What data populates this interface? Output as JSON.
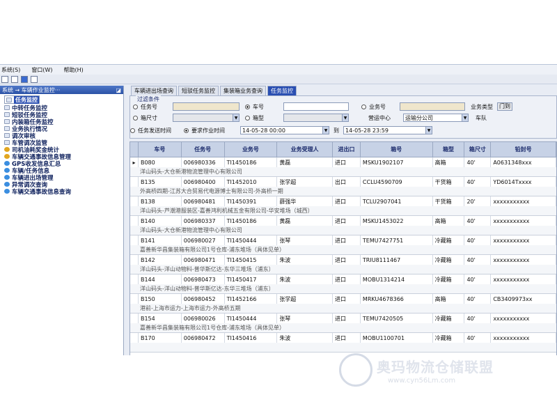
{
  "menu": [
    "系统(S)",
    "窗口(W)",
    "帮助(H)"
  ],
  "left_panel": {
    "header": "系统 → 车辆作业监控···",
    "items": [
      {
        "label": "任务监控",
        "icon": "doc-icon",
        "selected": true
      },
      {
        "label": "中转任务监控",
        "icon": "doc-icon"
      },
      {
        "label": "短驳任务监控",
        "icon": "doc-icon"
      },
      {
        "label": "内装箱任务监控",
        "icon": "doc-icon"
      },
      {
        "label": "业务执行情况",
        "icon": "doc-icon"
      },
      {
        "label": "调次审核",
        "icon": "doc-icon"
      },
      {
        "label": "车管调次监管",
        "icon": "doc-icon"
      },
      {
        "label": "司机油耗奖金统计",
        "icon": "key-icon"
      },
      {
        "label": "车辆交通事故信息管理",
        "icon": "key-icon"
      },
      {
        "label": "GPS收发信息汇总",
        "icon": "globe-icon"
      },
      {
        "label": "车辆/任务信息",
        "icon": "globe-icon"
      },
      {
        "label": "车辆进出场管理",
        "icon": "globe-icon"
      },
      {
        "label": "异常调次查询",
        "icon": "globe-icon"
      },
      {
        "label": "车辆交通事故信息查询",
        "icon": "globe-icon"
      }
    ]
  },
  "tabs": [
    "车辆进出场查询",
    "短驳任务监控",
    "集装箱业务查询",
    "任务监控"
  ],
  "active_tab": 3,
  "filter": {
    "title": "过滤条件",
    "task_no_label": "任务号",
    "car_no_label": "车号",
    "business_no_label": "业务号",
    "business_type_label": "业务类型",
    "business_type_value": "门到",
    "box_size_label": "箱尺寸",
    "box_type_label": "箱型",
    "center_label": "营运中心",
    "center_value": "运输分公司",
    "team_label": "车队",
    "send_time_label": "任务发送时间",
    "req_time_label": "要求作业时间",
    "time_from": "14-05-28 00:00",
    "to_label": "到",
    "time_to": "14-05-28 23:59"
  },
  "table": {
    "columns": [
      "车号",
      "任务号",
      "业务号",
      "业务受理人",
      "进出口",
      "箱号",
      "箱型",
      "箱尺寸",
      "铅封号"
    ],
    "rows": [
      {
        "cells": [
          "B080",
          "006980336",
          "TI1450186",
          "黄磊",
          "进口",
          "MSKU1902107",
          "高箱",
          "40'",
          "A0631348xxx"
        ],
        "sub": "洋山码头-大仓新港物流管理中心有限公司",
        "marker": "▸"
      },
      {
        "cells": [
          "B135",
          "006980400",
          "TI1452010",
          "张学超",
          "出口",
          "CCLU4590709",
          "干货箱",
          "40'",
          "YD6014Txxxx"
        ],
        "sub": "外高桥四期-江苏大合贸易代电源博士有限公司-外高桥一期"
      },
      {
        "cells": [
          "B138",
          "006980481",
          "TI1450391",
          "薛强华",
          "进口",
          "TCLU2907041",
          "干货箱",
          "20'",
          "xxxxxxxxxxx"
        ],
        "sub": "洋山码头-芦潮港服装区-嘉善鸿利机械五金有限公司-华安堆场（城西）"
      },
      {
        "cells": [
          "B140",
          "006980337",
          "TI1450186",
          "黄磊",
          "进口",
          "MSKU1453022",
          "高箱",
          "40'",
          "xxxxxxxxxxx"
        ],
        "sub": "洋山码头-大仓新港物流管理中心有限公司"
      },
      {
        "cells": [
          "B141",
          "006980027",
          "TI1450444",
          "张琴",
          "进口",
          "TEMU7427751",
          "冷藏箱",
          "40'",
          "xxxxxxxxxxx"
        ],
        "sub": "嘉善新华昌集装箱有限公司1号仓库-浦东堆场（具体见单）"
      },
      {
        "cells": [
          "B142",
          "006980471",
          "TI1450415",
          "朱波",
          "进口",
          "TRIU8111467",
          "冷藏箱",
          "40'",
          "xxxxxxxxxxx"
        ],
        "sub": "洋山码头-洋山动物料-普华斯亿达-东华三堆场（浦东）"
      },
      {
        "cells": [
          "B144",
          "006980473",
          "TI1450417",
          "朱波",
          "进口",
          "MOBU1314214",
          "冷藏箱",
          "40'",
          "xxxxxxxxxxx"
        ],
        "sub": "洋山码头-洋山动物料-普华斯亿达-东华三堆场（浦东）"
      },
      {
        "cells": [
          "B150",
          "006980452",
          "TI1452166",
          "张学超",
          "进口",
          "MRKU4678366",
          "高箱",
          "40'",
          "CB3409973xx"
        ],
        "sub": "港前-上海市运力-上海市运力-外高桥五期"
      },
      {
        "cells": [
          "B154",
          "006980026",
          "TI1450444",
          "张琴",
          "进口",
          "TEMU7420505",
          "冷藏箱",
          "40'",
          "xxxxxxxxxxx"
        ],
        "sub": "嘉善新华昌集装箱有限公司1号仓库-浦东堆场（具体见单）"
      },
      {
        "cells": [
          "B170",
          "006980472",
          "TI1450416",
          "朱波",
          "进口",
          "MOBU1100701",
          "冷藏箱",
          "40'",
          "xxxxxxxxxxx"
        ],
        "sub": ""
      }
    ]
  },
  "watermark": {
    "text": "奥玛物流仓储联盟",
    "url": "www.cyn56Lm.com"
  }
}
